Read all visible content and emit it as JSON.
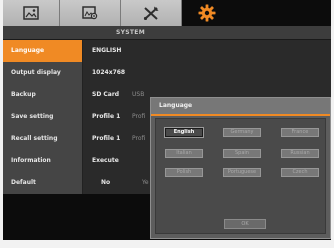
{
  "tabs": [
    {
      "icon": "picture-icon",
      "active": false
    },
    {
      "icon": "image-settings-icon",
      "active": false
    },
    {
      "icon": "tools-icon",
      "active": false
    },
    {
      "icon": "gear-icon",
      "active": true
    }
  ],
  "colors": {
    "accent": "#f08a24",
    "panel": "#454545",
    "dialog": "#5d5d5d"
  },
  "header": {
    "title": "SYSTEM"
  },
  "settings": {
    "language": {
      "label": "Language",
      "value": "ENGLISH"
    },
    "output_display": {
      "label": "Output display",
      "value": "1024x768"
    },
    "backup": {
      "label": "Backup",
      "value": "SD Card",
      "extra": "USB"
    },
    "save_setting": {
      "label": "Save setting",
      "value": "Profile 1",
      "extra": "Profi"
    },
    "recall_setting": {
      "label": "Recall setting",
      "value": "Profile 1",
      "extra": "Profi"
    },
    "information": {
      "label": "Information",
      "value": "Execute"
    },
    "default": {
      "label": "Default",
      "value": "No",
      "extra": "Ye"
    }
  },
  "language_dialog": {
    "title": "Language",
    "selected": "English",
    "languages": [
      "English",
      "Germany",
      "France",
      "Italian",
      "Spain",
      "Russian",
      "Polish",
      "Portuguese",
      "Czech"
    ],
    "ok_label": "OK"
  }
}
